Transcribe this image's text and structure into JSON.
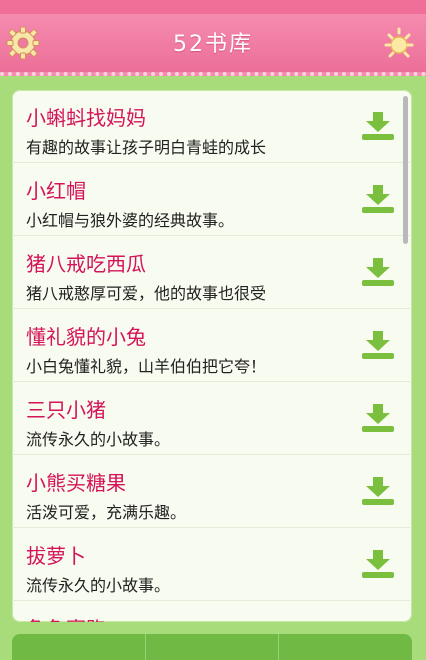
{
  "header": {
    "title": "52书库",
    "left_icon": "gear-icon",
    "right_icon": "sun-icon"
  },
  "colors": {
    "header": "#ef7aa1",
    "title_text": "#d4145a",
    "background": "#a8dc7a",
    "download_icon": "#7bbf3e"
  },
  "stories": [
    {
      "title": "小蝌蚪找妈妈",
      "desc": "有趣的故事让孩子明白青蛙的成长"
    },
    {
      "title": "小红帽",
      "desc": "小红帽与狼外婆的经典故事。"
    },
    {
      "title": "猪八戒吃西瓜",
      "desc": "猪八戒憨厚可爱，他的故事也很受"
    },
    {
      "title": "懂礼貌的小兔",
      "desc": "小白兔懂礼貌，山羊伯伯把它夸！"
    },
    {
      "title": "三只小猪",
      "desc": "流传永久的小故事。"
    },
    {
      "title": "小熊买糖果",
      "desc": "活泼可爱，充满乐趣。"
    },
    {
      "title": "拔萝卜",
      "desc": "流传永久的小故事。"
    },
    {
      "title": "龟兔赛跑",
      "desc": ""
    }
  ]
}
